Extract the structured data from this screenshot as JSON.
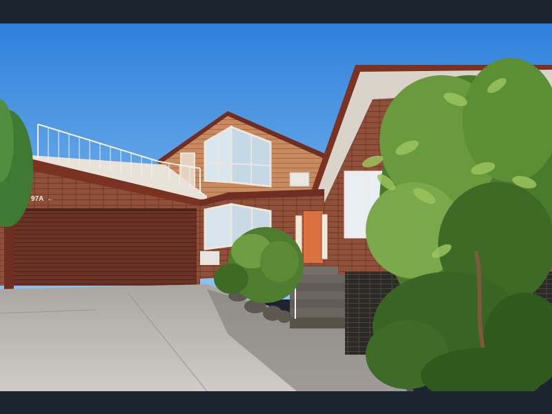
{
  "photo": {
    "house_number_sign": "97A",
    "sign_arrow": "←"
  },
  "colors": {
    "sky": "#3f8fe0",
    "brick": "#8a4a35",
    "garage_door": "#6b3326",
    "foliage": "#5f8f3a",
    "driveway": "#bdbab5"
  }
}
